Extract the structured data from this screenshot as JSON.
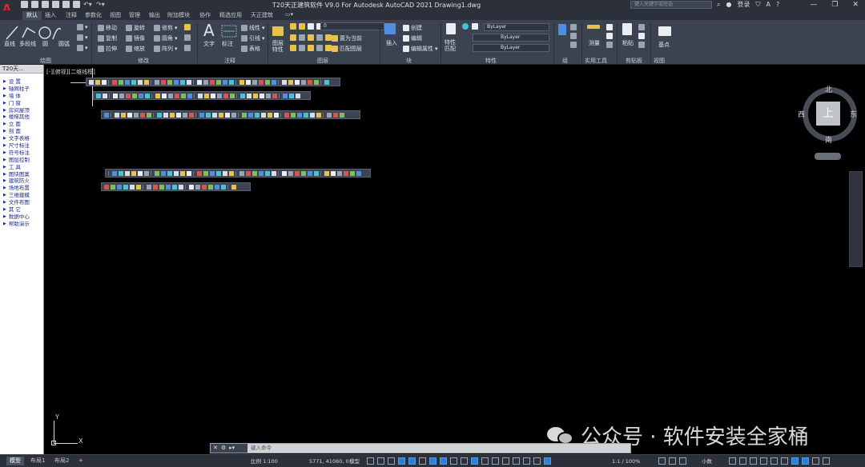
{
  "titlebar": {
    "title": "T20天正建筑软件 V9.0 For Autodesk AutoCAD 2021    Drawing1.dwg",
    "search_placeholder": "键入关键字或短语",
    "login": "登录",
    "app_logo": "A"
  },
  "ribbon_tabs": [
    "默认",
    "插入",
    "注释",
    "参数化",
    "视图",
    "管理",
    "输出",
    "附加模块",
    "协作",
    "精选应用",
    "天正建筑"
  ],
  "ribbon": {
    "draw": {
      "label": "绘图",
      "items": [
        "直线",
        "多段线",
        "圆",
        "圆弧"
      ]
    },
    "modify": {
      "label": "修改",
      "items": [
        "移动",
        "旋转",
        "修剪",
        "复制",
        "镜像",
        "圆角",
        "拉伸",
        "缩放",
        "阵列"
      ]
    },
    "annotation": {
      "label": "注释",
      "items": [
        "文字",
        "标注",
        "线性",
        "引线",
        "表格"
      ]
    },
    "layers": {
      "label": "图层",
      "items": [
        "图层特性",
        "置为当前",
        "匹配图层"
      ],
      "current_layer": "0"
    },
    "block": {
      "label": "块",
      "items": [
        "插入",
        "创建",
        "编辑",
        "编辑属性"
      ]
    },
    "properties": {
      "label": "特性",
      "items": [
        "特性匹配"
      ],
      "color": "ByLayer",
      "linetype": "ByLayer",
      "lineweight": "ByLayer"
    },
    "groups": {
      "label": "组",
      "items": [
        "组"
      ]
    },
    "utilities": {
      "label": "实用工具",
      "items": [
        "测量"
      ]
    },
    "clipboard": {
      "label": "剪贴板",
      "items": [
        "粘贴"
      ]
    },
    "view": {
      "label": "视图",
      "items": [
        "基点"
      ]
    }
  },
  "left_menu": {
    "title": "T20天...",
    "items": [
      "设    置",
      "轴网柱子",
      "墙    体",
      "门    窗",
      "房间屋顶",
      "楼梯其他",
      "立    面",
      "剖    面",
      "文字表格",
      "尺寸标注",
      "符号标注",
      "图层控制",
      "工    具",
      "图块图案",
      "建筑防火",
      "场地布置",
      "三维建模",
      "文件布图",
      "其    它",
      "数据中心",
      "帮助演示"
    ]
  },
  "viewport": {
    "label": "[-][俯视][二维线框]"
  },
  "viewcube": {
    "north": "北",
    "south": "南",
    "east": "东",
    "west": "西",
    "face": "上"
  },
  "ucs": {
    "x": "X",
    "y": "Y"
  },
  "cmdline": {
    "placeholder": "键入命令"
  },
  "watermark": {
    "text": "公众号 · 软件安装全家桶"
  },
  "statusbar": {
    "tabs": [
      "模型",
      "布局1",
      "布局2"
    ],
    "add_tab": "+",
    "scale": "比例 1:100",
    "coords": "5771, 41060, 0",
    "mode": "模型",
    "annotation_scale": "1:1 / 100%",
    "units": "小数"
  }
}
